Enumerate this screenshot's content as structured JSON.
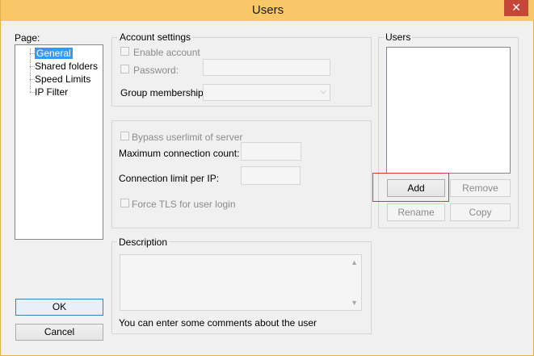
{
  "window": {
    "title": "Users",
    "close_glyph": "✕"
  },
  "page_panel": {
    "label": "Page:",
    "items": [
      "General",
      "Shared folders",
      "Speed Limits",
      "IP Filter"
    ],
    "selected": "General"
  },
  "account": {
    "group_label": "Account settings",
    "enable_account": "Enable account",
    "password": "Password:",
    "password_value": "",
    "group_membership": "Group membership:",
    "group_membership_value": ""
  },
  "limits": {
    "bypass": "Bypass userlimit of server",
    "max_conn": "Maximum connection count:",
    "max_conn_value": "",
    "conn_per_ip": "Connection limit per IP:",
    "conn_per_ip_value": "",
    "force_tls": "Force TLS for user login"
  },
  "description": {
    "group_label": "Description",
    "hint": "You can enter some comments about the user",
    "value": ""
  },
  "users": {
    "group_label": "Users",
    "add": "Add",
    "remove": "Remove",
    "rename": "Rename",
    "copy": "Copy"
  },
  "footer": {
    "ok": "OK",
    "cancel": "Cancel"
  },
  "colors": {
    "title_bar": "#f8c768",
    "close": "#c7463a",
    "selection": "#3399ff",
    "highlight": "#dd3333"
  }
}
